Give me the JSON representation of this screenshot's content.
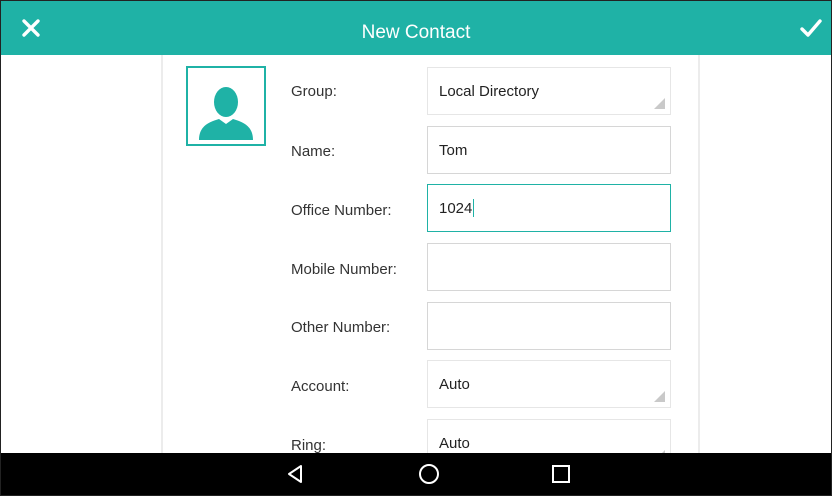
{
  "header": {
    "title": "New Contact",
    "cancel_icon": "close-icon",
    "confirm_icon": "checkmark-icon",
    "bg_color": "#1fb2a6"
  },
  "avatar": {
    "icon": "person-icon",
    "color": "#1fb2a6"
  },
  "form": {
    "group": {
      "label": "Group:",
      "value": "Local Directory"
    },
    "name": {
      "label": "Name:",
      "value": "Tom"
    },
    "office_number": {
      "label": "Office Number:",
      "value": "1024"
    },
    "mobile_number": {
      "label": "Mobile Number:",
      "value": ""
    },
    "other_number": {
      "label": "Other Number:",
      "value": ""
    },
    "account": {
      "label": "Account:",
      "value": "Auto"
    },
    "ring": {
      "label": "Ring:",
      "value": "Auto"
    }
  },
  "navbar": {
    "back_icon": "back-triangle-icon",
    "home_icon": "home-circle-icon",
    "recents_icon": "recents-square-icon"
  }
}
